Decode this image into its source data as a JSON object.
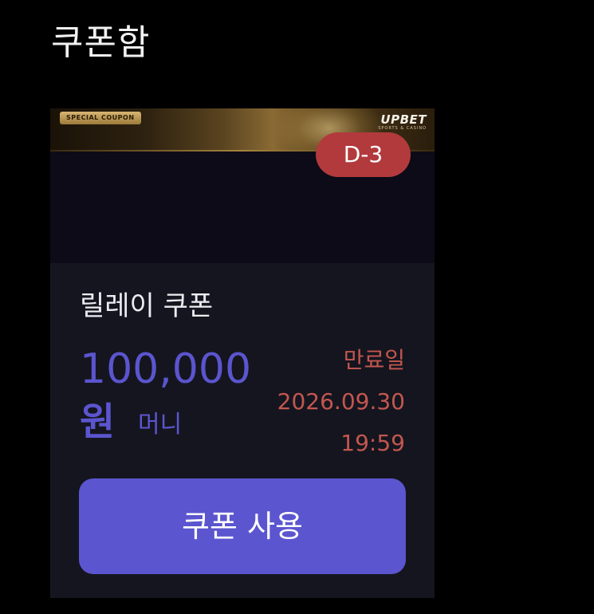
{
  "page": {
    "title": "쿠폰함"
  },
  "coupon": {
    "banner": {
      "tag": "SPECIAL COUPON",
      "brand": "UPBET",
      "brand_sub": "SPORTS & CASINO"
    },
    "dday": "D-3",
    "name": "릴레이 쿠폰",
    "amount": "100,000",
    "currency": "원",
    "money_type": "머니",
    "expiry": {
      "label": "만료일",
      "date": "2026.09.30",
      "time": "19:59"
    },
    "use_button_label": "쿠폰 사용"
  },
  "colors": {
    "background": "#000000",
    "card": "#15151f",
    "accent": "#5b55cf",
    "dday_badge": "#b23a3c",
    "expiry_text": "#c2574f"
  }
}
